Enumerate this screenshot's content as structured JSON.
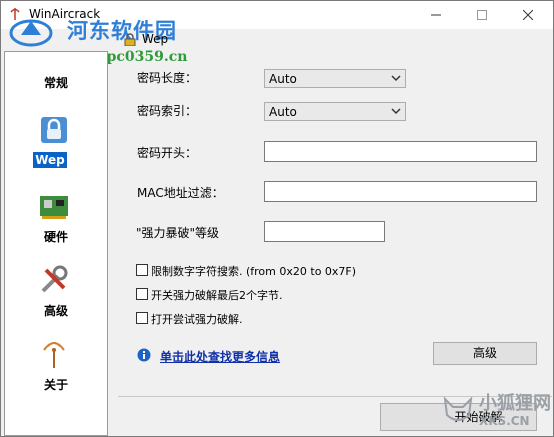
{
  "window": {
    "title": "WinAircrack"
  },
  "watermark": {
    "site_name": "河东软件园",
    "site_url": "www.pc0359.cn",
    "corner_line1": "小狐狸网",
    "corner_line2": "XKS.CN"
  },
  "sidebar": {
    "items": [
      {
        "label": "常规",
        "icon": "general-icon",
        "active": false
      },
      {
        "label": "Wep",
        "icon": "lock-icon",
        "active": true
      },
      {
        "label": "硬件",
        "icon": "hardware-card-icon",
        "active": false
      },
      {
        "label": "高级",
        "icon": "tools-icon",
        "active": false
      },
      {
        "label": "关于",
        "icon": "antenna-icon",
        "active": false
      }
    ]
  },
  "panel": {
    "title": "Wep",
    "key_length": {
      "label": "密码长度：",
      "value": "Auto"
    },
    "key_index": {
      "label": "密码索引：",
      "value": "Auto"
    },
    "key_prefix": {
      "label": "密码开头：",
      "value": ""
    },
    "mac_filter": {
      "label": "MAC地址过滤：",
      "value": ""
    },
    "bruteforce_level": {
      "label": "\"强力暴破\"等级",
      "value": ""
    },
    "options": [
      {
        "label": "限制数字字符搜索. (from 0x20 to 0x7F)",
        "checked": false
      },
      {
        "label": "开关强力破解最后2个字节.",
        "checked": false
      },
      {
        "label": "打开尝试强力破解.",
        "checked": false
      }
    ],
    "info_link": "单击此处查找更多信息",
    "advanced_button": "高级",
    "start_button": "开始破解"
  },
  "colors": {
    "accent": "#0a64c8",
    "link": "#1030a8",
    "watermark_blue": "#2f7fd8",
    "watermark_green": "#2f9a3a"
  }
}
